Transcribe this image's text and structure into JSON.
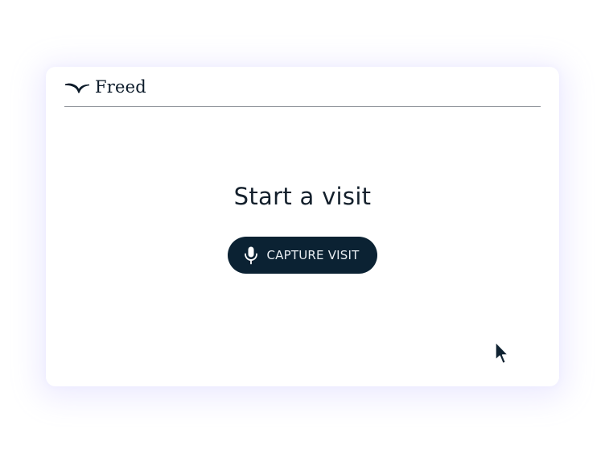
{
  "app": {
    "brand_name": "Freed",
    "logo_icon": "bird-wing-icon"
  },
  "main": {
    "heading": "Start a visit",
    "capture_button": {
      "label": "CAPTURE VISIT",
      "icon": "microphone-icon"
    }
  },
  "colors": {
    "button_background": "#0b2233",
    "text_dark": "#14202c",
    "card_shadow": "#aaa0ff"
  }
}
